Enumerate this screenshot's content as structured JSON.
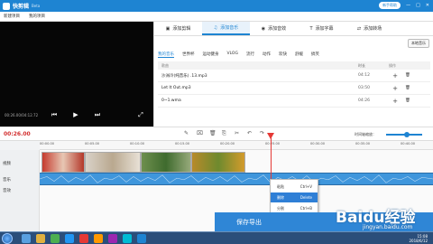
{
  "app": {
    "title": "快剪辑",
    "badge": "Beta",
    "help": "新手帮助"
  },
  "menu": [
    "新建项目",
    "我的项目"
  ],
  "preview": {
    "time": "00:26.00/04:12.72"
  },
  "tabs": [
    "添加剪辑",
    "添加音乐",
    "添加音效",
    "添加字幕",
    "添加转场"
  ],
  "active_tab": 1,
  "local_button": "本地音乐",
  "categories": [
    "我的音乐",
    "世界杯",
    "运动健身",
    "VLOG",
    "流行",
    "动作",
    "欢快",
    "舒缓",
    "搞笑"
  ],
  "columns": {
    "name": "歌曲",
    "duration": "时长",
    "action": "操作"
  },
  "songs": [
    {
      "name": "沙洲冷(纯音乐) .13.mp3",
      "duration": "04:12"
    },
    {
      "name": "Let It Out.mp3",
      "duration": "03:50"
    },
    {
      "name": "0~1.wma",
      "duration": "04:26"
    }
  ],
  "toolbar": {
    "time": "00:26.00",
    "zoom_label": "时间轴缩放："
  },
  "ruler": [
    "00:00.00",
    "00:05.00",
    "00:10.00",
    "00:15.00",
    "00:20.00",
    "00:25.00",
    "00:30.00",
    "00:35.00",
    "00:40.00"
  ],
  "tracks": {
    "video": "视频",
    "music": "音乐",
    "sfx": "音效"
  },
  "context_menu": [
    {
      "label": "粘贴",
      "key": "Ctrl+V"
    },
    {
      "label": "删除",
      "key": "Delete"
    },
    {
      "label": "分割",
      "key": "Ctrl+B"
    },
    {
      "label": "静音",
      "key": "Alt+S"
    }
  ],
  "context_selected": 1,
  "save_button": "保存导出",
  "watermark": {
    "brand": "Baidu经验",
    "url": "jingyan.baidu.com"
  },
  "clock": {
    "time": "15:08",
    "date": "2018/6/12"
  }
}
